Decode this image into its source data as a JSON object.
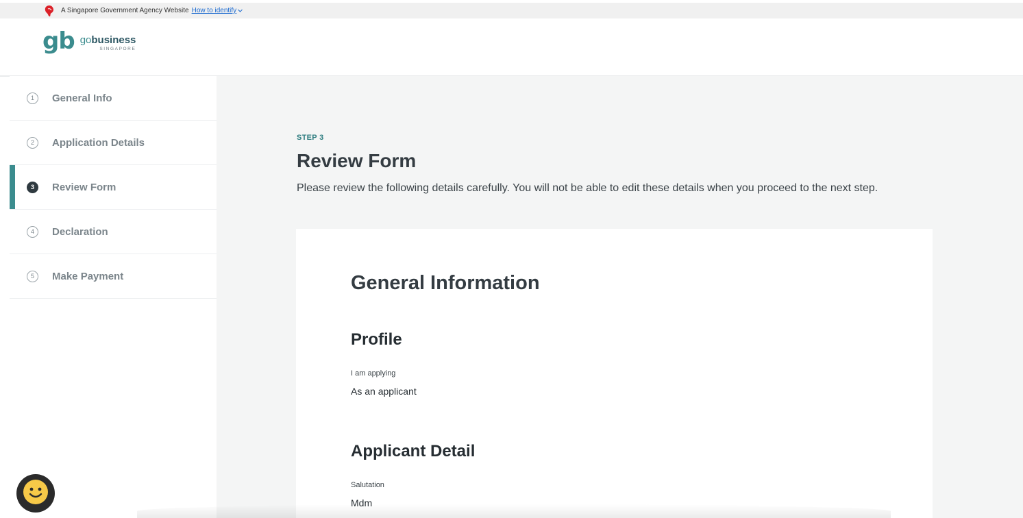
{
  "masthead": {
    "gov_text": "A Singapore Government Agency Website",
    "identify_link": "How to identify"
  },
  "logo": {
    "mark": "gb",
    "word_go": "go",
    "word_business": "business",
    "sub": "SINGAPORE"
  },
  "sidebar": {
    "steps": [
      {
        "num": "1",
        "label": "General Info",
        "active": false
      },
      {
        "num": "2",
        "label": "Application Details",
        "active": false
      },
      {
        "num": "3",
        "label": "Review Form",
        "active": true
      },
      {
        "num": "4",
        "label": "Declaration",
        "active": false
      },
      {
        "num": "5",
        "label": "Make Payment",
        "active": false
      }
    ]
  },
  "main": {
    "kicker": "STEP 3",
    "title": "Review Form",
    "description": "Please review the following details carefully. You will not be able to edit these details when you proceed to the next step.",
    "card": {
      "section_title": "General Information",
      "profile": {
        "title": "Profile",
        "field_label": "I am applying",
        "field_value": "As an applicant"
      },
      "applicant": {
        "title": "Applicant Detail",
        "field_label": "Salutation",
        "field_value": "Mdm"
      }
    }
  },
  "colors": {
    "accent": "#3b8c8e",
    "link": "#1b6ad0",
    "feedback_face": "#f7c948"
  },
  "icons": {
    "masthead": "lion-head-icon",
    "identify": "chevron-down-icon",
    "feedback": "smiley-face-icon"
  }
}
